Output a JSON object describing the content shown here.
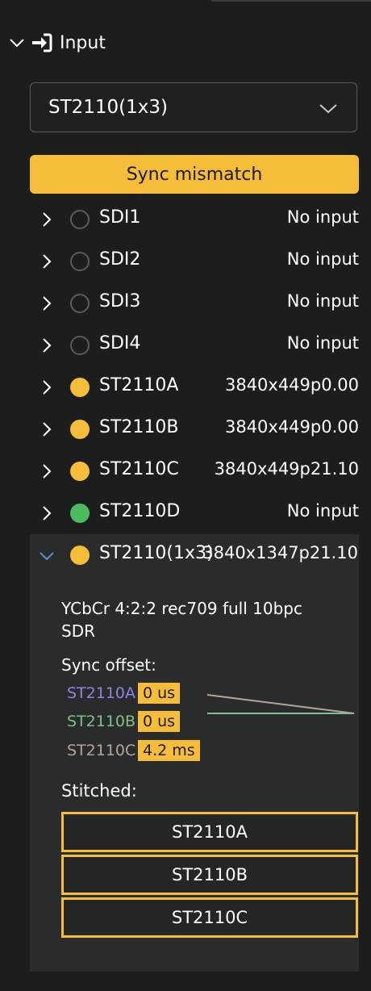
{
  "section": {
    "title": "Input"
  },
  "select": {
    "value": "ST2110(1x3)"
  },
  "sync_banner": "Sync mismatch",
  "inputs": [
    {
      "name": "SDI1",
      "status": "No input",
      "state": "off"
    },
    {
      "name": "SDI2",
      "status": "No input",
      "state": "off"
    },
    {
      "name": "SDI3",
      "status": "No input",
      "state": "off"
    },
    {
      "name": "SDI4",
      "status": "No input",
      "state": "off"
    },
    {
      "name": "ST2110A",
      "status": "3840x449p0.00",
      "state": "warning"
    },
    {
      "name": "ST2110B",
      "status": "3840x449p0.00",
      "state": "warning"
    },
    {
      "name": "ST2110C",
      "status": "3840x449p21.10",
      "state": "warning"
    },
    {
      "name": "ST2110D",
      "status": "No input",
      "state": "ok"
    }
  ],
  "expanded": {
    "name": "ST2110(1x3)",
    "status": "3840x1347p21.10",
    "format": "YCbCr 4:2:2 rec709 full 10bpc SDR",
    "sync_offset_label": "Sync offset:",
    "offsets": [
      {
        "source": "ST2110A",
        "value": "0 us",
        "color": "#8a86e6"
      },
      {
        "source": "ST2110B",
        "value": "0 us",
        "color": "#7fbf8a"
      },
      {
        "source": "ST2110C",
        "value": "4.2 ms",
        "color": "#b3a59a"
      }
    ],
    "stitched_label": "Stitched:",
    "stitched": [
      "ST2110A",
      "ST2110B",
      "ST2110C"
    ]
  },
  "colors": {
    "accent": "#f5bd3a",
    "ok": "#4cbb5b",
    "background": "#1c1d1d",
    "panel": "#2a2b2b"
  },
  "icons": {
    "section_chevron": "chevron-down-icon",
    "section_icon": "sign-in-icon",
    "select_chevron": "chevron-down-icon",
    "row_chevron": "chevron-right-icon",
    "expanded_chevron": "chevron-down-icon"
  }
}
